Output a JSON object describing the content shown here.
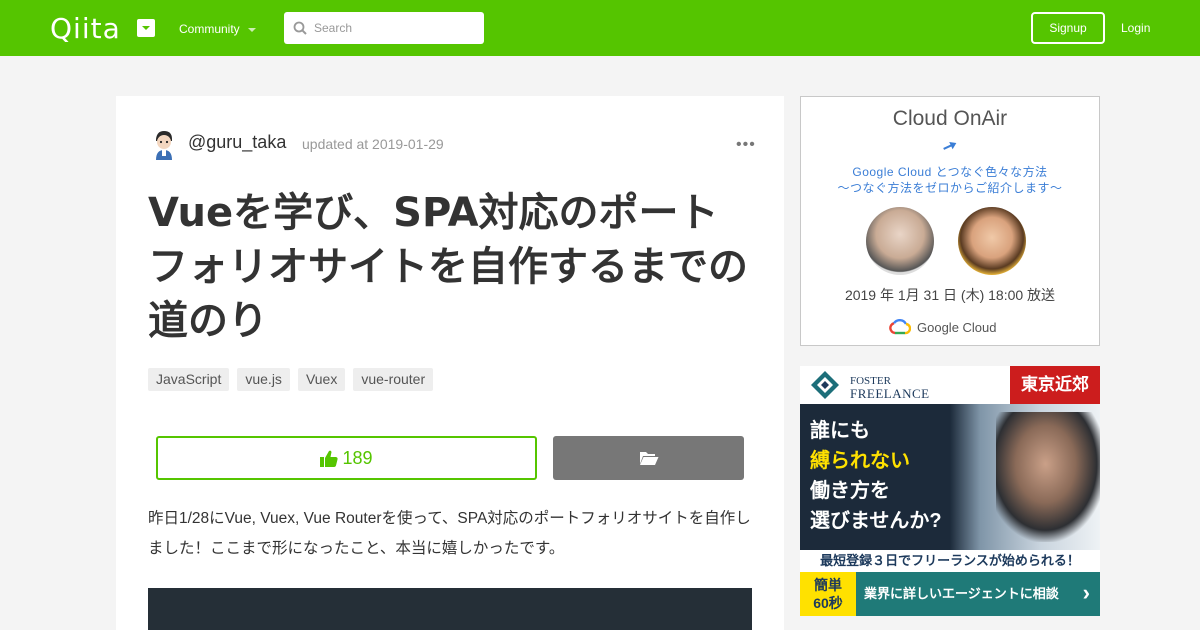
{
  "header": {
    "logo": "Qiita",
    "community_label": "Community",
    "search_placeholder": "Search",
    "signup_label": "Signup",
    "login_label": "Login"
  },
  "article": {
    "author": "@guru_taka",
    "updated": "updated at 2019-01-29",
    "more": "•••",
    "title": "Vueを学び、SPA対応のポートフォリオサイトを自作するまでの道のり",
    "tags": [
      "JavaScript",
      "vue.js",
      "Vuex",
      "vue-router"
    ],
    "like_count": "189",
    "body": "昨日1/28にVue, Vuex, Vue Routerを使って、SPA対応のポートフォリオサイトを自作しました！ここまで形になったこと、本当に嬉しかったです。"
  },
  "ads": {
    "cloud": {
      "title": "Cloud OnAir",
      "line1": "Google Cloud とつなぐ色々な方法",
      "line2": "〜つなぐ方法をゼロからご紹介します〜",
      "date": "2019 年 1月 31 日 (木) 18:00 放送",
      "brand": "Google Cloud"
    },
    "foster": {
      "brand1": "FOSTER",
      "brand2": "FREELANCE",
      "region": "東京近郊",
      "copy1": "誰にも",
      "copy2": "縛られない",
      "copy3": "働き方を",
      "copy4": "選びませんか?",
      "bar": "最短登録３日でフリーランスが始められる！",
      "badge1": "簡単",
      "badge2": "60秒",
      "cta": "業界に詳しいエージェントに相談",
      "arrow": "›"
    }
  },
  "colors": {
    "brand_green": "#55c500",
    "link_blue": "#3b7ed6"
  }
}
